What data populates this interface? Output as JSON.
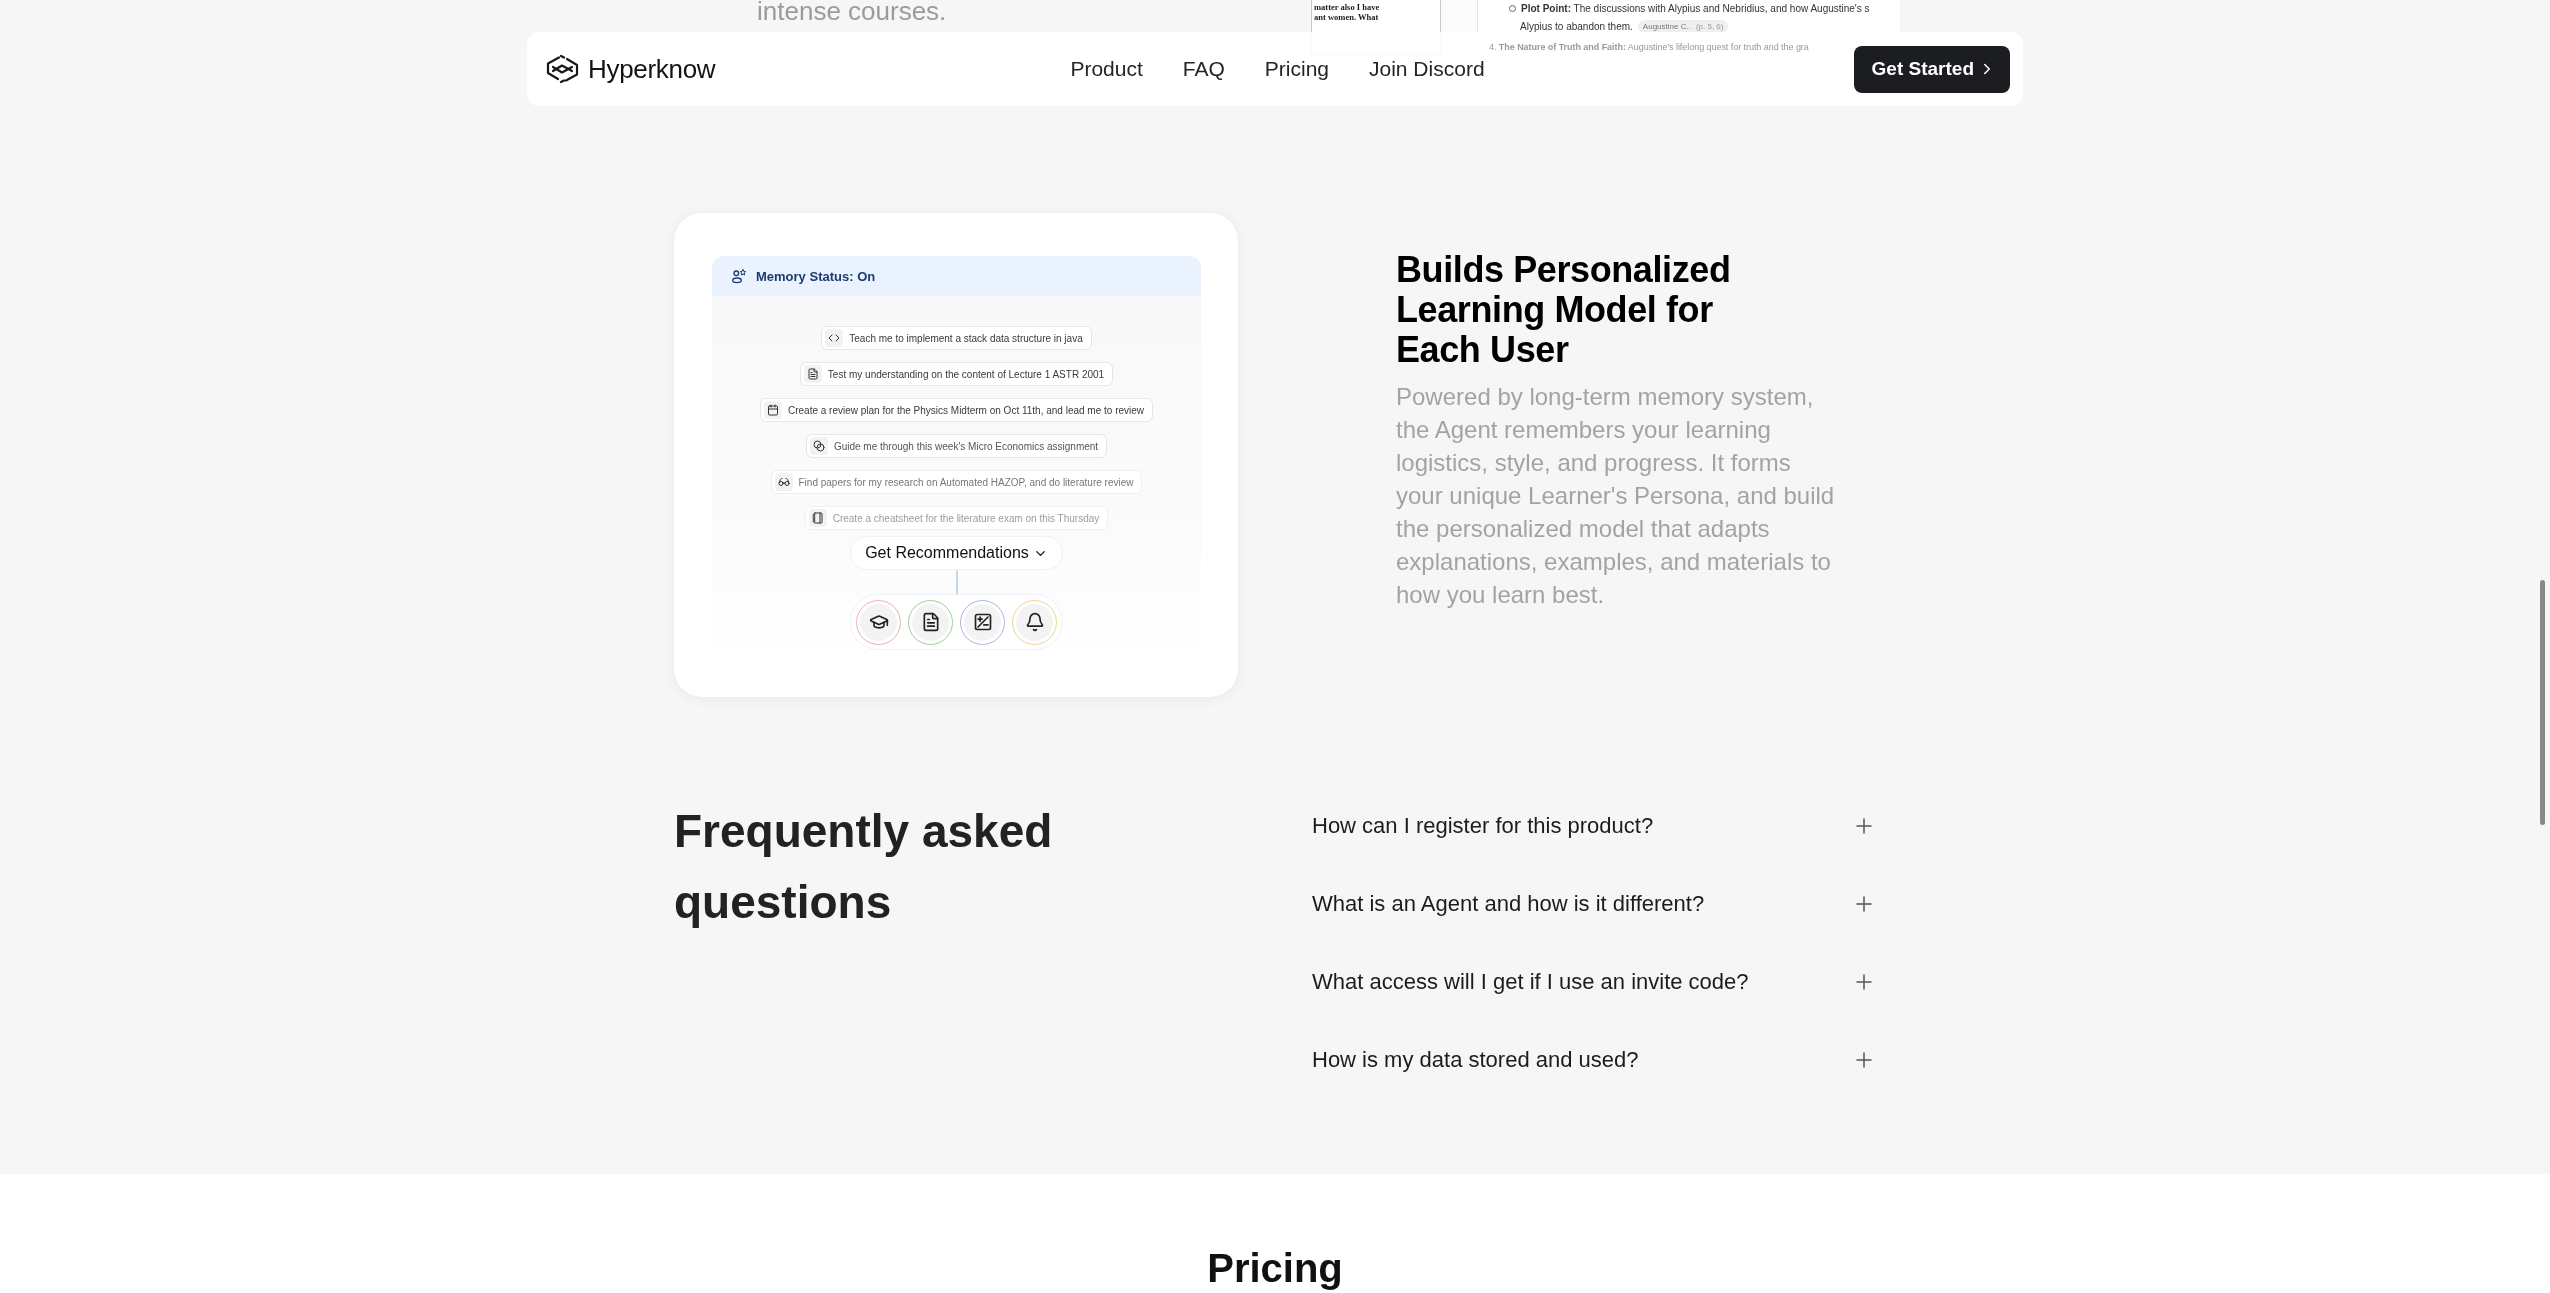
{
  "previous_section": {
    "text": "intense courses.",
    "document_lines": [
      "matter also I have",
      "ant women. What"
    ],
    "outline": {
      "point": "**Plot Point:** The discussions with Alypius and Nebridius, and how Augustine's s",
      "continuation": "Alypius to abandon them.",
      "citation": "Augustine C..",
      "pages": "(p. 5, 6)",
      "next_heading": "4. **The Nature of Truth and Faith:** Augustine's lifelong quest for truth and the gra"
    }
  },
  "nav": {
    "brand": "Hyperknow",
    "links": [
      "Product",
      "FAQ",
      "Pricing",
      "Join Discord"
    ],
    "cta": "Get Started"
  },
  "feature": {
    "memory_status": "Memory Status: On",
    "prompts": [
      "Teach me to implement a stack data structure in java",
      "Test my understanding on the content of Lecture 1 ASTR 2001",
      "Create a review plan for the Physics Midterm on Oct 11th, and lead me to review",
      "Guide me through this week's Micro Economics assignment",
      "Find papers for my research on Automated HAZOP, and do literature review",
      "Create a cheatsheet for the literature exam on this Thursday"
    ],
    "button": "Get Recommendations",
    "tools": [
      {
        "color": "#f0b4ae"
      },
      {
        "color": "#9ed49a"
      },
      {
        "color": "#a9bbe3"
      },
      {
        "color": "#f2d88c"
      }
    ],
    "title": "Builds Personalized Learning Model for Each User",
    "description": "Powered by long-term memory system, the Agent remembers your learning logistics, style, and progress. It forms your unique Learner's Persona, and build the personalized model that adapts explanations, examples, and materials to how you learn best."
  },
  "faq": {
    "title": "Frequently asked questions",
    "items": [
      {
        "question": "How can I register for this product?",
        "expanded": false
      },
      {
        "question": "What is an Agent and how is it different?",
        "expanded": false
      },
      {
        "question": "What access will I get if I use an invite code?",
        "expanded": false
      },
      {
        "question": "How is my data stored and used?",
        "expanded": false
      }
    ]
  },
  "pricing": {
    "title": "Pricing"
  }
}
